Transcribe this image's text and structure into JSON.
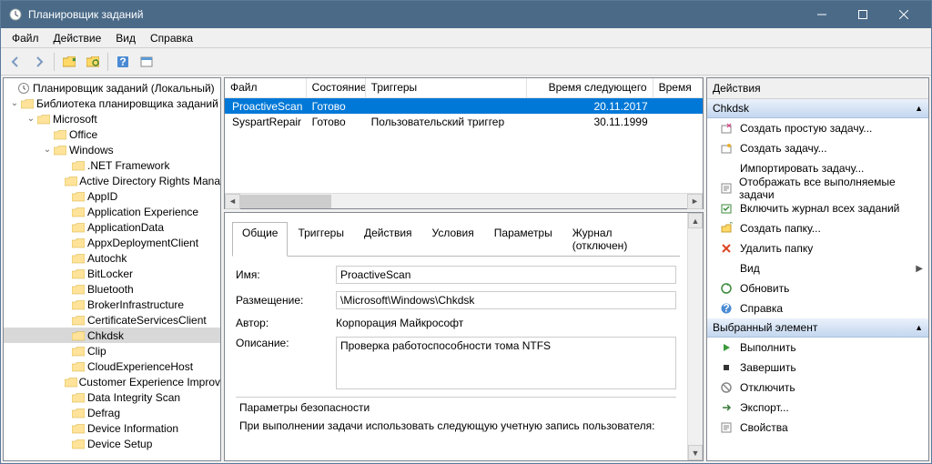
{
  "window": {
    "title": "Планировщик заданий"
  },
  "menu": {
    "file": "Файл",
    "action": "Действие",
    "view": "Вид",
    "help": "Справка"
  },
  "tree": {
    "root": "Планировщик заданий (Локальный)",
    "lib": "Библиотека планировщика заданий",
    "ms": "Microsoft",
    "office": "Office",
    "win": "Windows",
    "nodes": [
      ".NET Framework",
      "Active Directory Rights Mana",
      "AppID",
      "Application Experience",
      "ApplicationData",
      "AppxDeploymentClient",
      "Autochk",
      "BitLocker",
      "Bluetooth",
      "BrokerInfrastructure",
      "CertificateServicesClient",
      "Chkdsk",
      "Clip",
      "CloudExperienceHost",
      "Customer Experience Improv",
      "Data Integrity Scan",
      "Defrag",
      "Device Information",
      "Device Setup"
    ]
  },
  "columns": {
    "file": "Файл",
    "state": "Состояние",
    "triggers": "Триггеры",
    "next": "Время следующего запуска",
    "prev": "Время пр"
  },
  "tasks": [
    {
      "name": "ProactiveScan",
      "state": "Готово",
      "trigger": "",
      "next": "20.11.2017"
    },
    {
      "name": "SyspartRepair",
      "state": "Готово",
      "trigger": "Пользовательский триггер",
      "next": "30.11.1999"
    }
  ],
  "tabs": {
    "general": "Общие",
    "triggers": "Триггеры",
    "actions": "Действия",
    "conditions": "Условия",
    "settings": "Параметры",
    "history": "Журнал (отключен)"
  },
  "detail": {
    "name_label": "Имя:",
    "name": "ProactiveScan",
    "loc_label": "Размещение:",
    "loc": "\\Microsoft\\Windows\\Chkdsk",
    "author_label": "Автор:",
    "author": "Корпорация Майкрософт",
    "desc_label": "Описание:",
    "desc": "Проверка работоспособности тома NTFS",
    "sec_label": "Параметры безопасности",
    "sec_text": "При выполнении задачи использовать следующую учетную запись пользователя:"
  },
  "actions": {
    "title": "Действия",
    "group1": "Chkdsk",
    "items1": [
      "Создать простую задачу...",
      "Создать задачу...",
      "Импортировать задачу...",
      "Отображать все выполняемые задачи",
      "Включить журнал всех заданий",
      "Создать папку...",
      "Удалить папку",
      "Вид",
      "Обновить",
      "Справка"
    ],
    "group2": "Выбранный элемент",
    "items2": [
      "Выполнить",
      "Завершить",
      "Отключить",
      "Экспорт...",
      "Свойства"
    ]
  }
}
